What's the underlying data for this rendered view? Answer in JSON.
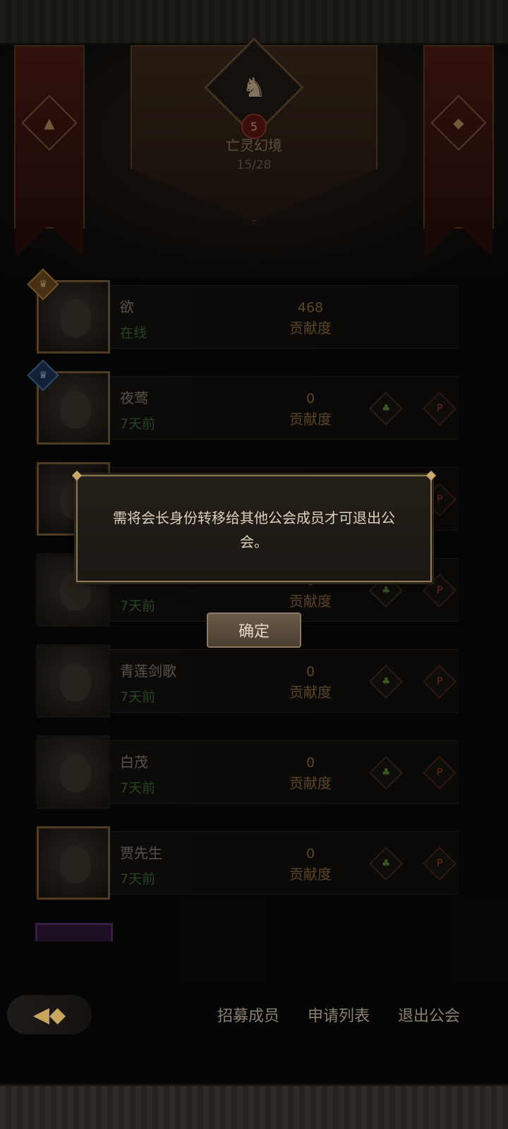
{
  "guild": {
    "level": "5",
    "name": "亡灵幻境",
    "member_count": "15/28"
  },
  "members": [
    {
      "name": "欲",
      "status": "在线",
      "contribution": "468",
      "contribution_label": "贡献度",
      "rank_icon": "crown-icon"
    },
    {
      "name": "夜莺",
      "status": "7天前",
      "contribution": "0",
      "contribution_label": "贡献度",
      "rank_icon": "crown-icon"
    },
    {
      "name": "",
      "status": "",
      "contribution": "",
      "contribution_label": "",
      "rank_icon": ""
    },
    {
      "name": "",
      "status": "7天前",
      "contribution": "0",
      "contribution_label": "贡献度"
    },
    {
      "name": "青莲剑歌",
      "status": "7天前",
      "contribution": "0",
      "contribution_label": "贡献度"
    },
    {
      "name": "白茂",
      "status": "7天前",
      "contribution": "0",
      "contribution_label": "贡献度"
    },
    {
      "name": "贾先生",
      "status": "7天前",
      "contribution": "0",
      "contribution_label": "贡献度"
    }
  ],
  "dialog": {
    "message": "需将会长身份转移给其他公会成员才可退出公会。",
    "confirm_label": "确定"
  },
  "bottom_bar": {
    "recruit_label": "招募成员",
    "apply_list_label": "申请列表",
    "quit_label": "退出公会"
  },
  "icons": {
    "guild_crest": "unicorn-icon",
    "back": "back-arrow-icon",
    "promote": "promote-icon",
    "kick": "kick-icon"
  },
  "colors": {
    "online": "#3e6b3a",
    "contribution": "#8a6a3e",
    "dialog_border": "#8f7a55"
  }
}
